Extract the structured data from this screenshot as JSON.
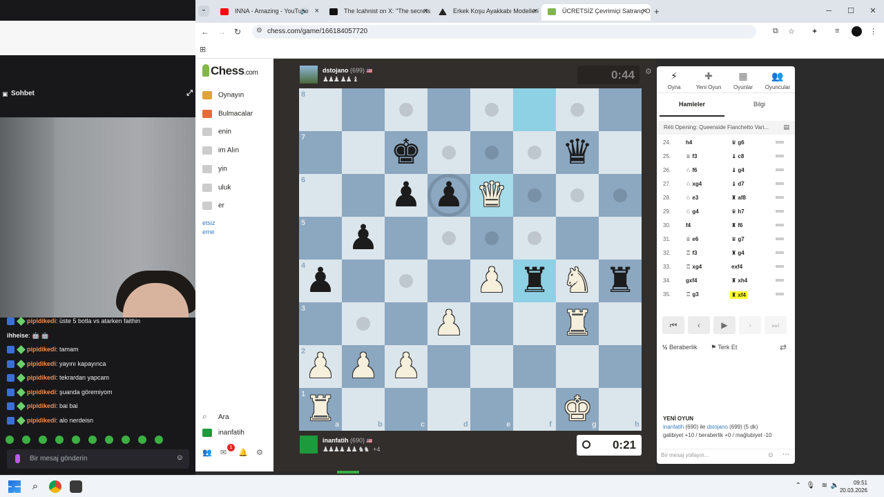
{
  "browser": {
    "tabs": [
      {
        "label": "INNA - Amazing - YouTube",
        "fav_color": "#ff0000"
      },
      {
        "label": "The Icahnist on X: \"The secrets",
        "fav_color": "#111111"
      },
      {
        "label": "Erkek Koşu Ayakkabı Modelleri",
        "fav_color": "#222222"
      },
      {
        "label": "ÜCRETSİZ Çevrimiçi Satranç Oy",
        "fav_color": "#81b64c"
      }
    ],
    "url": "chess.com/game/166184057720"
  },
  "stream": {
    "chat_title": "Sohbet",
    "messages": [
      {
        "user": "pipidikedi",
        "text": ": üste 5 botla vs atarken faithin",
        "badges": true
      },
      {
        "user": "ihheise",
        "text": ": 🤖 🤖",
        "badges": false
      },
      {
        "user": "pipidikedi",
        "text": ": tamam",
        "badges": true
      },
      {
        "user": "pipidikedi",
        "text": ": yayını kapayınca",
        "badges": true
      },
      {
        "user": "pipidikedi",
        "text": ": tekrardan yapcam",
        "badges": true
      },
      {
        "user": "pipidikedi",
        "text": ": şuanda göremiyom",
        "badges": true
      },
      {
        "user": "pipidikedi",
        "text": ": bai bai",
        "badges": true
      },
      {
        "user": "pipidikedi",
        "text": ": alo nerdeisn",
        "badges": true
      }
    ],
    "chat_placeholder": "Bir mesaj gönderin"
  },
  "sidebar": {
    "logo": "Chess",
    "logo_suffix": ".com",
    "items": [
      {
        "label": "Oynayın",
        "color": "#e0a23a"
      },
      {
        "label": "Bulmacalar",
        "color": "#e86b3a"
      },
      {
        "label": "enin",
        "color": "#cccccc"
      },
      {
        "label": "im Alın",
        "color": "#cccccc"
      },
      {
        "label": "yin",
        "color": "#cccccc"
      },
      {
        "label": "uluk",
        "color": "#cccccc"
      },
      {
        "label": "er",
        "color": "#cccccc"
      }
    ],
    "promo": [
      "etsiz",
      "eme"
    ],
    "search": "Ara",
    "user": "inanfatih",
    "notif_count": "1"
  },
  "game": {
    "top_player": {
      "name": "dstojano",
      "rating": "(699)",
      "captured": "♟♟♟ ♟♟ ♝"
    },
    "top_clock": "0:44",
    "bottom_player": {
      "name": "inanfatih",
      "rating": "(690)",
      "captured": "♟♟♟♟ ♟♟ ♞♞",
      "advantage": "+4"
    },
    "bottom_clock": "0:21",
    "files": [
      "a",
      "b",
      "c",
      "d",
      "e",
      "f",
      "g",
      "h"
    ],
    "ranks": [
      "8",
      "7",
      "6",
      "5",
      "4",
      "3",
      "2",
      "1"
    ],
    "pieces": [
      {
        "sq": "c7",
        "glyph": "♚",
        "color": "b"
      },
      {
        "sq": "g7",
        "glyph": "♛",
        "color": "b"
      },
      {
        "sq": "c6",
        "glyph": "♟",
        "color": "b"
      },
      {
        "sq": "d6",
        "glyph": "♟",
        "color": "b"
      },
      {
        "sq": "e6",
        "glyph": "♛",
        "color": "w"
      },
      {
        "sq": "b5",
        "glyph": "♟",
        "color": "b"
      },
      {
        "sq": "a4",
        "glyph": "♟",
        "color": "b"
      },
      {
        "sq": "e4",
        "glyph": "♟",
        "color": "w"
      },
      {
        "sq": "f4",
        "glyph": "♜",
        "color": "b"
      },
      {
        "sq": "g4",
        "glyph": "♞",
        "color": "w"
      },
      {
        "sq": "h4",
        "glyph": "♜",
        "color": "b"
      },
      {
        "sq": "d3",
        "glyph": "♟",
        "color": "w"
      },
      {
        "sq": "g3",
        "glyph": "♜",
        "color": "w"
      },
      {
        "sq": "a2",
        "glyph": "♟",
        "color": "w"
      },
      {
        "sq": "b2",
        "glyph": "♟",
        "color": "w"
      },
      {
        "sq": "c2",
        "glyph": "♟",
        "color": "w"
      },
      {
        "sq": "a1",
        "glyph": "♜",
        "color": "w"
      },
      {
        "sq": "g1",
        "glyph": "♚",
        "color": "w"
      }
    ],
    "highlights": [
      "f8",
      "e6",
      "f4"
    ],
    "hints": [
      "c8",
      "e8",
      "g8",
      "d7",
      "e7",
      "f7",
      "f6",
      "g6",
      "h6",
      "d5",
      "e5",
      "f5",
      "c4",
      "b3"
    ],
    "rings": [
      "d6"
    ]
  },
  "panel": {
    "tabs": [
      {
        "label": "Oyna",
        "icon": "⚡"
      },
      {
        "label": "Yeni Oyun",
        "icon": "✚"
      },
      {
        "label": "Oyunlar",
        "icon": "▦"
      },
      {
        "label": "Oyuncular",
        "icon": "👥"
      }
    ],
    "subtabs": [
      "Hamleler",
      "Bilgi"
    ],
    "opening": "Réti Opening: Queenside Fianchetto Vari...",
    "moves": [
      {
        "n": "24.",
        "w": "h4",
        "b": "♛ g6"
      },
      {
        "n": "25.",
        "w": "♕ f3",
        "b": "♝ c8"
      },
      {
        "n": "26.",
        "w": "♘ f6",
        "b": "♝ g4"
      },
      {
        "n": "27.",
        "w": "♘ xg4",
        "b": "♝ d7"
      },
      {
        "n": "28.",
        "w": "♘ e3",
        "b": "♜ af8"
      },
      {
        "n": "29.",
        "w": "♘ g4",
        "b": "♛ h7"
      },
      {
        "n": "30.",
        "w": "f4",
        "b": "♜ f6"
      },
      {
        "n": "31.",
        "w": "♕ e6",
        "b": "♛ g7"
      },
      {
        "n": "32.",
        "w": "♖ f3",
        "b": "♜ g4"
      },
      {
        "n": "33.",
        "w": "♖ xg4",
        "b": "exf4"
      },
      {
        "n": "34.",
        "w": "gxf4",
        "b": "♜ xh4"
      },
      {
        "n": "35.",
        "w": "♖ g3",
        "b": "♜ xf4"
      }
    ],
    "controls": [
      "⏮",
      "‹",
      "▶",
      "›",
      "⏭"
    ],
    "draw": "Beraberlik",
    "resign": "Terk Et",
    "newgame_title": "YENİ OYUN",
    "newgame_p1": "inanfatih",
    "newgame_r1": " (690) ile ",
    "newgame_p2": "dstojano",
    "newgame_r2": " (699) (5 dk)",
    "newgame_line2": "galibiyet +10 / beraberlik +0 / mağlubiyet -10",
    "msg_placeholder": "Bir mesaj yollayın..."
  },
  "taskbar": {
    "time": "09:51",
    "date": "20.03.2026"
  }
}
